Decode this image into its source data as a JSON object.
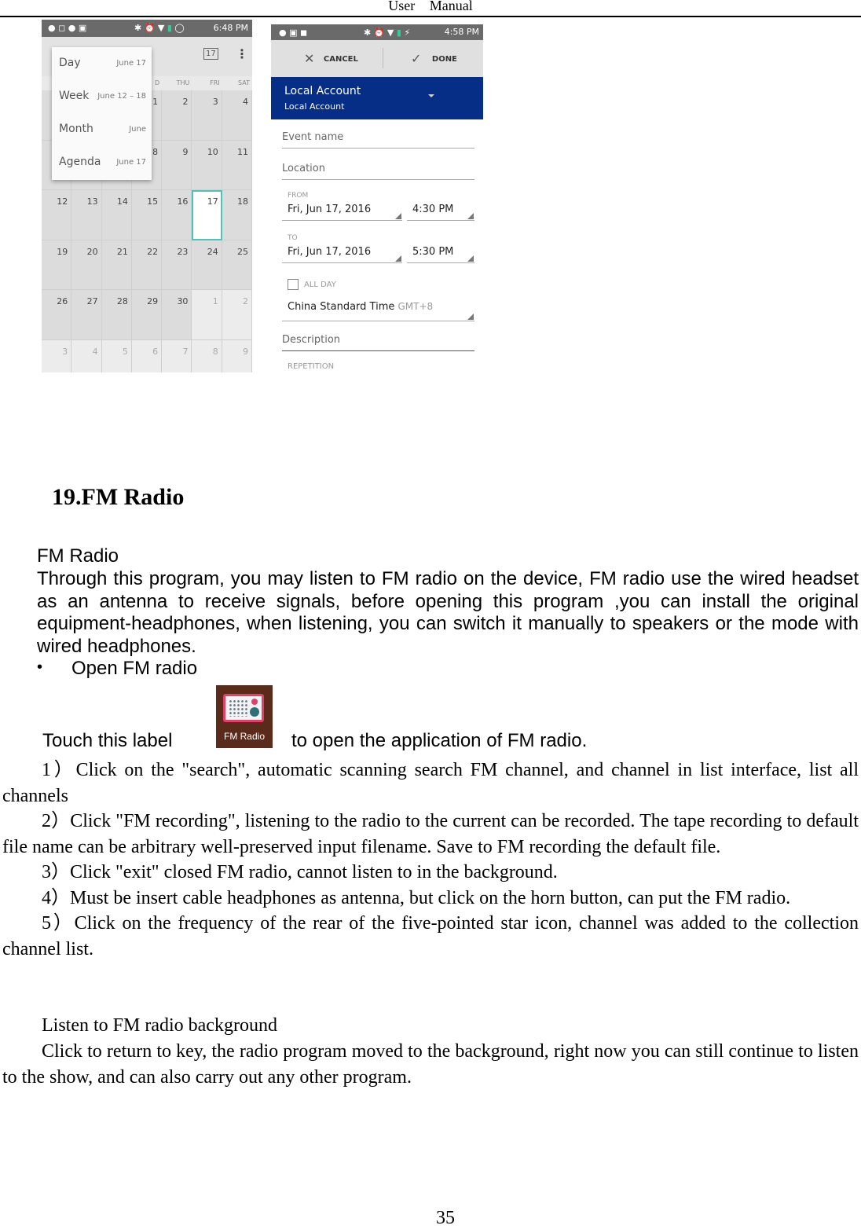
{
  "header": {
    "title": "User Manual"
  },
  "calendar_screen": {
    "status_time": "6:48 PM",
    "today_icon": "17",
    "menu": [
      {
        "label": "Day",
        "range": "June 17"
      },
      {
        "label": "Week",
        "range": "June 12 – 18"
      },
      {
        "label": "Month",
        "range": "June"
      },
      {
        "label": "Agenda",
        "range": "June 17"
      }
    ],
    "day_headers": [
      "",
      "",
      "",
      "D",
      "THU",
      "FRI",
      "SAT"
    ],
    "weeks": [
      [
        "",
        "",
        "",
        "1",
        "2",
        "3",
        "4"
      ],
      [
        "",
        "",
        "",
        "8",
        "9",
        "10",
        "11"
      ],
      [
        "12",
        "13",
        "14",
        "15",
        "16",
        "17",
        "18"
      ],
      [
        "19",
        "20",
        "21",
        "22",
        "23",
        "24",
        "25"
      ],
      [
        "26",
        "27",
        "28",
        "29",
        "30",
        "1",
        "2"
      ],
      [
        "3",
        "4",
        "5",
        "6",
        "7",
        "8",
        "9"
      ]
    ],
    "today": "17",
    "accent": "#4fc3b8"
  },
  "event_screen": {
    "status_time": "4:58 PM",
    "cancel": "CANCEL",
    "done": "DONE",
    "account_title": "Local Account",
    "account_sub": "Local Account",
    "event_name": "Event name",
    "location": "Location",
    "from_label": "FROM",
    "from_date": "Fri, Jun 17, 2016",
    "from_time": "4:30 PM",
    "to_label": "TO",
    "to_date": "Fri, Jun 17, 2016",
    "to_time": "5:30 PM",
    "all_day": "ALL DAY",
    "timezone": "China Standard Time",
    "gmt": "GMT+8",
    "description": "Description",
    "repetition": "REPETITION",
    "brand_color": "#062e86"
  },
  "section": {
    "title": "19.FM Radio",
    "subtitle": "FM Radio",
    "intro": "Through this program, you may listen to FM radio on the device, FM radio use the wired headset as an antenna to receive signals, before opening this program ,you can install  the original equipment-headphones, when listening, you can switch it manually  to speakers or the mode with wired headphones.",
    "bullet": "Open FM radio",
    "touch_before": "Touch this label",
    "icon_label": "FM Radio",
    "touch_after": "to open the application of FM radio.",
    "steps": [
      "1）Click on the \"search\", automatic scanning search FM channel, and channel in list interface, list all channels",
      "2）Click \"FM recording\", listening to the radio to the current can be recorded. The tape recording to default file name can be arbitrary well-preserved input filename. Save to FM recording the default file.",
      "3）Click \"exit\" closed FM radio, cannot listen to in the background.",
      "4）Must be insert cable headphones as antenna, but click on the horn button, can put the FM radio.",
      "5）Click on the frequency of the rear of the five-pointed star icon, channel was added to the collection channel list."
    ],
    "bg_title": "Listen to FM radio background",
    "bg_text": "Click to return to key, the radio program moved to the background, right now you can still continue to listen to the show, and can also carry out any other program."
  },
  "page_number": "35"
}
